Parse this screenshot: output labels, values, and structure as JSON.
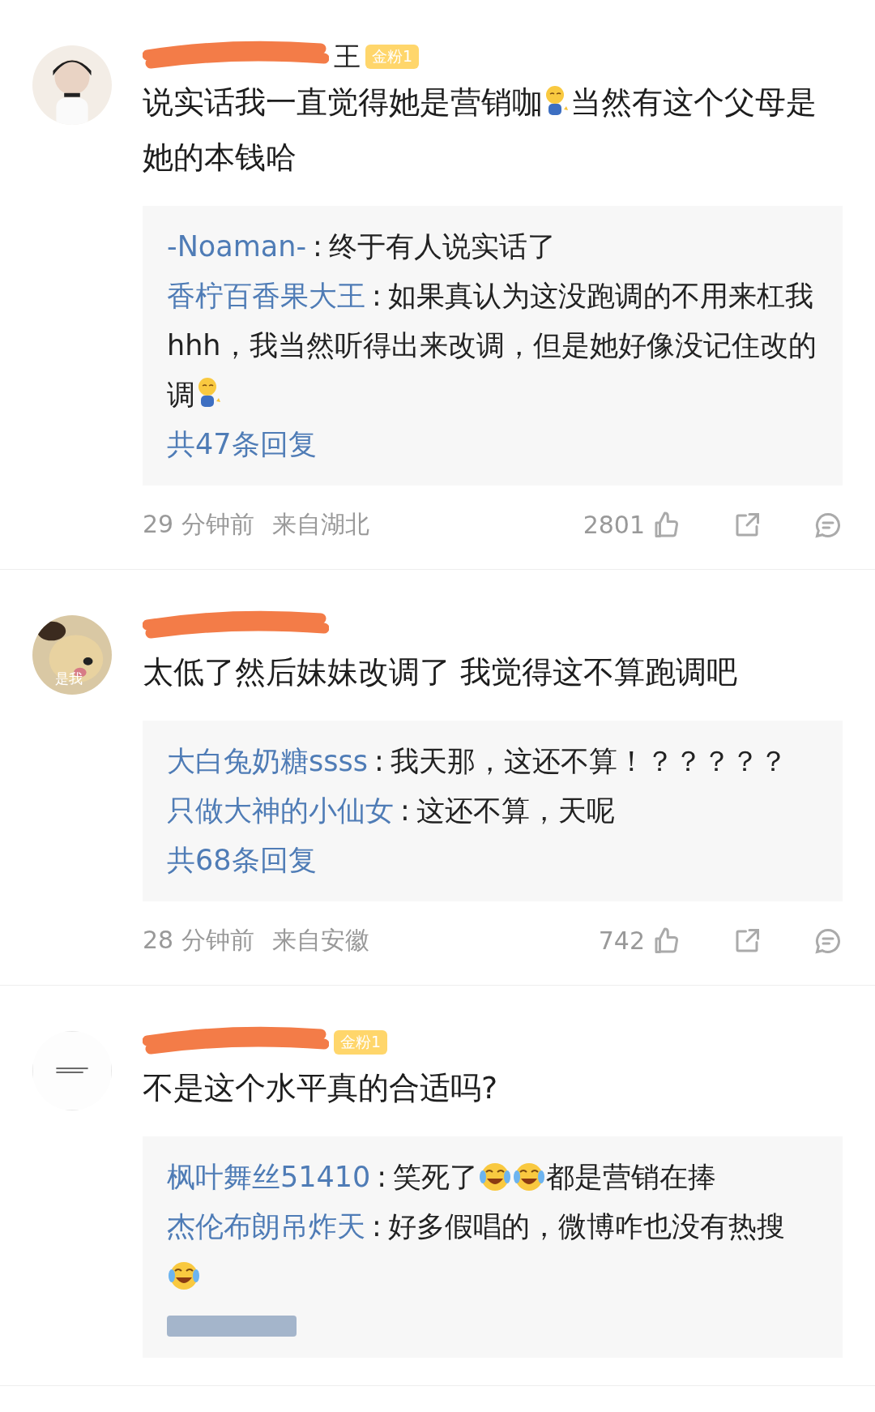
{
  "comments": [
    {
      "avatar": {
        "kind": "person-photo"
      },
      "username_tail": "王",
      "badge": "金粉1",
      "text": [
        {
          "kind": "text",
          "text": "说实话我一直觉得她是营销咖"
        },
        {
          "kind": "bow-emoji"
        },
        {
          "kind": "text",
          "text": "当然有这个父母是她的本钱哈"
        }
      ],
      "replies": [
        {
          "user": "-Noaman-",
          "separator": ":",
          "parts": [
            {
              "kind": "text",
              "text": "终于有人说实话了"
            }
          ]
        },
        {
          "user": "香柠百香果大王",
          "separator": ":",
          "parts": [
            {
              "kind": "text",
              "text": "如果真认为这没跑调的不用来杠我hhh，我当然听得出来改调，但是她好像没记住改的调"
            },
            {
              "kind": "bow-emoji"
            }
          ]
        }
      ],
      "reply_count": "共47条回复",
      "time": "29 分钟前",
      "location": "来自湖北",
      "likes": "2801"
    },
    {
      "avatar": {
        "kind": "dog-photo"
      },
      "avatar_caption": "是我",
      "text": [
        {
          "kind": "text",
          "text": "太低了然后妹妹改调了 我觉得这不算跑调吧"
        }
      ],
      "replies": [
        {
          "user": "大白兔奶糖ssss",
          "separator": ":",
          "parts": [
            {
              "kind": "text",
              "text": "我天那，这还不算！？？？？？"
            }
          ]
        },
        {
          "user": "只做大神的小仙女",
          "separator": ":",
          "parts": [
            {
              "kind": "text",
              "text": "这还不算，天呢"
            }
          ]
        }
      ],
      "reply_count": "共68条回复",
      "time": "28 分钟前",
      "location": "来自安徽",
      "likes": "742"
    },
    {
      "avatar": {
        "kind": "blank-image"
      },
      "badge": "金粉1",
      "text": [
        {
          "kind": "text",
          "text": "不是这个水平真的合适吗?"
        }
      ],
      "replies": [
        {
          "user": "枫叶舞丝51410",
          "separator": ":",
          "parts": [
            {
              "kind": "text",
              "text": "笑死了"
            },
            {
              "kind": "laugh-cry-emoji"
            },
            {
              "kind": "laugh-cry-emoji"
            },
            {
              "kind": "text",
              "text": "都是营销在捧"
            }
          ]
        },
        {
          "user": "杰伦布朗吊炸天",
          "separator": ":",
          "parts": [
            {
              "kind": "text",
              "text": "好多假唱的，微博咋也没有热搜"
            },
            {
              "kind": "laugh-cry-emoji"
            }
          ]
        }
      ],
      "reply_count_blurred": true
    }
  ]
}
